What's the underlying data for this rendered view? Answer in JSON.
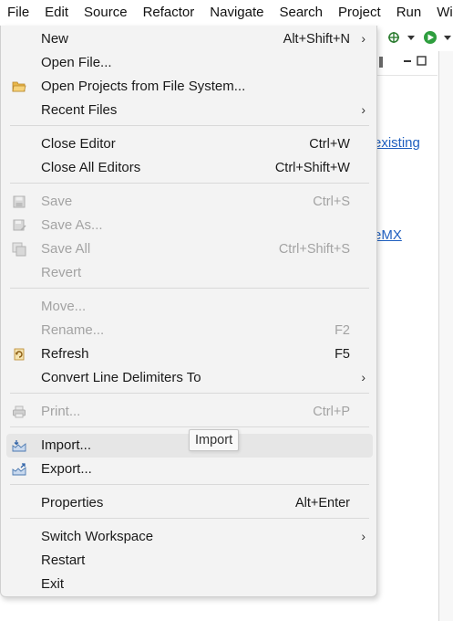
{
  "menubar": {
    "items": [
      {
        "label": "File"
      },
      {
        "label": "Edit"
      },
      {
        "label": "Source"
      },
      {
        "label": "Refactor"
      },
      {
        "label": "Navigate"
      },
      {
        "label": "Search"
      },
      {
        "label": "Project"
      },
      {
        "label": "Run"
      },
      {
        "label": "Wi"
      }
    ]
  },
  "background": {
    "link_existing": "existing",
    "link_mx": "eMX"
  },
  "file_menu": {
    "new": {
      "label": "New",
      "accel": "Alt+Shift+N"
    },
    "open_file": {
      "label": "Open File..."
    },
    "open_projects": {
      "label": "Open Projects from File System..."
    },
    "recent_files": {
      "label": "Recent Files"
    },
    "close_editor": {
      "label": "Close Editor",
      "accel": "Ctrl+W"
    },
    "close_all_editors": {
      "label": "Close All Editors",
      "accel": "Ctrl+Shift+W"
    },
    "save": {
      "label": "Save",
      "accel": "Ctrl+S"
    },
    "save_as": {
      "label": "Save As..."
    },
    "save_all": {
      "label": "Save All",
      "accel": "Ctrl+Shift+S"
    },
    "revert": {
      "label": "Revert"
    },
    "move": {
      "label": "Move..."
    },
    "rename": {
      "label": "Rename...",
      "accel": "F2"
    },
    "refresh": {
      "label": "Refresh",
      "accel": "F5"
    },
    "convert_line_delimiters": {
      "label": "Convert Line Delimiters To"
    },
    "print": {
      "label": "Print...",
      "accel": "Ctrl+P"
    },
    "import": {
      "label": "Import..."
    },
    "export": {
      "label": "Export..."
    },
    "properties": {
      "label": "Properties",
      "accel": "Alt+Enter"
    },
    "switch_workspace": {
      "label": "Switch Workspace"
    },
    "restart": {
      "label": "Restart"
    },
    "exit": {
      "label": "Exit"
    }
  },
  "tooltip": {
    "text": "Import"
  },
  "icons": {
    "folder": "open-folder-icon",
    "save": "floppy-disk-icon",
    "refresh": "refresh-icon",
    "print": "printer-icon",
    "import": "import-icon",
    "export": "export-icon",
    "submenu": "chevron-right-icon",
    "submenu_glyph": "›"
  },
  "colors": {
    "menu_bg": "#f3f3f3",
    "hover_bg": "#e6e6e6",
    "disabled_text": "#a3a3a3",
    "link": "#1f5fbf",
    "run_green": "#2e9e3e"
  }
}
